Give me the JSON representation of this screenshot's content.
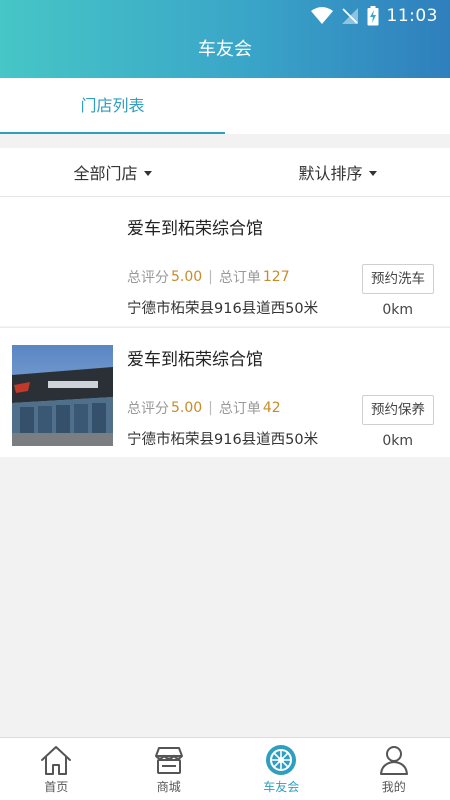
{
  "status": {
    "time": "11:03"
  },
  "header": {
    "title": "车友会"
  },
  "tabs": [
    {
      "label": "门店列表"
    }
  ],
  "filters": {
    "store_filter": "全部门店",
    "sort_filter": "默认排序"
  },
  "stores": [
    {
      "name": "爱车到柘荣综合馆",
      "rating_label": "总评分",
      "rating": "5.00",
      "orders_label": "总订单",
      "orders": "127",
      "address": "宁德市柘荣县916县道西50米",
      "action": "预约洗车",
      "distance": "0km",
      "has_image": false
    },
    {
      "name": "爱车到柘荣综合馆",
      "rating_label": "总评分",
      "rating": "5.00",
      "orders_label": "总订单",
      "orders": "42",
      "address": "宁德市柘荣县916县道西50米",
      "action": "预约保养",
      "distance": "0km",
      "has_image": true,
      "image_sign_text": "爱车到柘荣"
    }
  ],
  "bottom_nav": [
    {
      "label": "首页",
      "icon": "home-icon"
    },
    {
      "label": "商城",
      "icon": "store-icon"
    },
    {
      "label": "车友会",
      "icon": "wheel-icon",
      "active": true
    },
    {
      "label": "我的",
      "icon": "user-icon"
    }
  ],
  "colors": {
    "accent": "#2f9ec0",
    "price": "#c98b2a"
  }
}
